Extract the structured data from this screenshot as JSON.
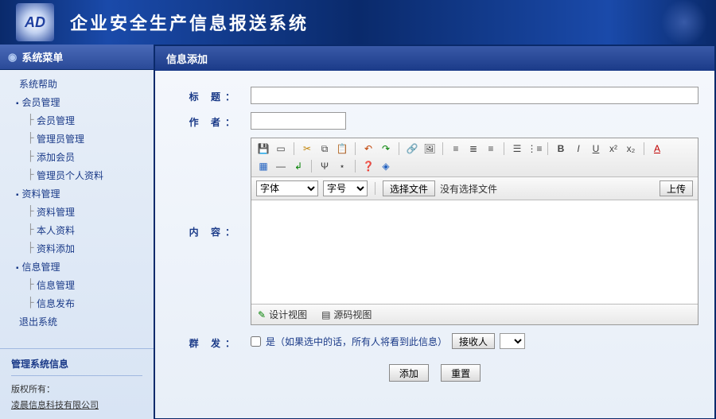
{
  "header": {
    "title": "企业安全生产信息报送系统",
    "logo_text": "AD"
  },
  "sidebar": {
    "title": "系统菜单",
    "items": [
      {
        "type": "item",
        "label": "系统帮助"
      },
      {
        "type": "group",
        "label": "会员管理",
        "children": [
          "会员管理",
          "管理员管理",
          "添加会员",
          "管理员个人资料"
        ]
      },
      {
        "type": "group",
        "label": "资料管理",
        "children": [
          "资料管理",
          "本人资料",
          "资料添加"
        ]
      },
      {
        "type": "group",
        "label": "信息管理",
        "children": [
          "信息管理",
          "信息发布"
        ]
      },
      {
        "type": "item",
        "label": "退出系统"
      }
    ],
    "info_title": "管理系统信息",
    "copyright_label": "版权所有：",
    "company": "凌晨信息科技有限公司"
  },
  "panel": {
    "title": "信息添加"
  },
  "form": {
    "labels": {
      "title": "标 题：",
      "author": "作 者：",
      "content": "内 容：",
      "mass": "群 发："
    },
    "mass_hint": "是（如果选中的话，所有人将看到此信息）",
    "recipient_btn": "接收人",
    "buttons": {
      "submit": "添加",
      "reset": "重置"
    }
  },
  "editor": {
    "font_label": "字体",
    "size_label": "字号",
    "file_btn": "选择文件",
    "file_text": "没有选择文件",
    "upload_btn": "上传",
    "tabs": {
      "design": "设计视图",
      "source": "源码视图"
    }
  }
}
